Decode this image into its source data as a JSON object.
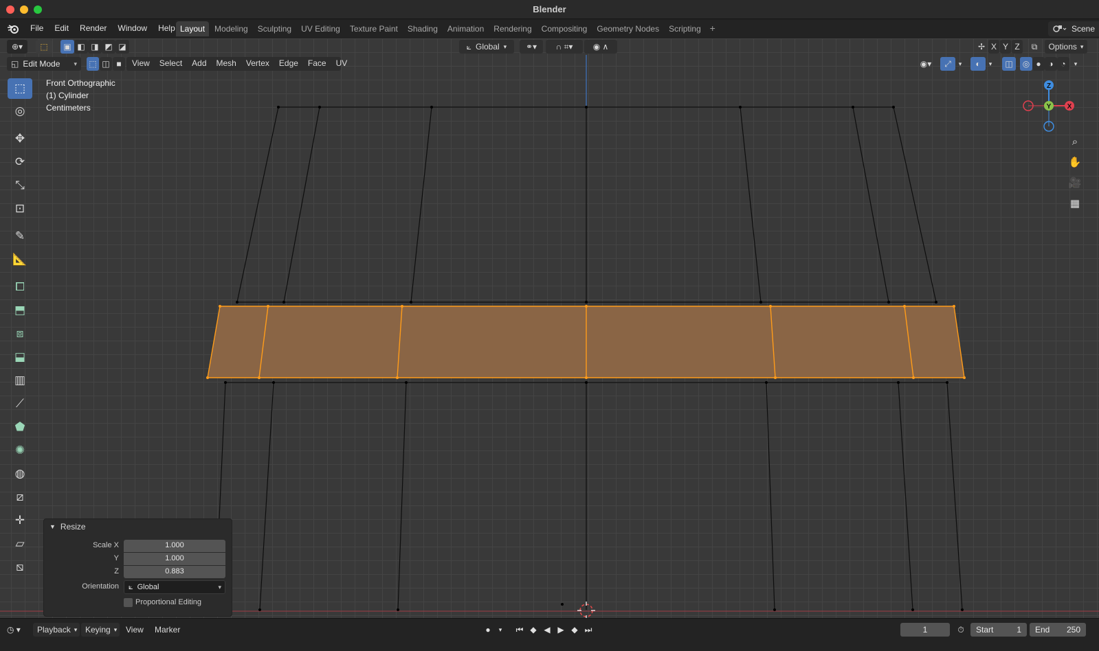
{
  "window": {
    "title": "Blender"
  },
  "menu": {
    "items": [
      "File",
      "Edit",
      "Render",
      "Window",
      "Help"
    ]
  },
  "workspaces": [
    {
      "label": "Layout",
      "active": true
    },
    {
      "label": "Modeling",
      "active": false
    },
    {
      "label": "Sculpting",
      "active": false
    },
    {
      "label": "UV Editing",
      "active": false
    },
    {
      "label": "Texture Paint",
      "active": false
    },
    {
      "label": "Shading",
      "active": false
    },
    {
      "label": "Animation",
      "active": false
    },
    {
      "label": "Rendering",
      "active": false
    },
    {
      "label": "Compositing",
      "active": false
    },
    {
      "label": "Geometry Nodes",
      "active": false
    },
    {
      "label": "Scripting",
      "active": false
    }
  ],
  "scene": {
    "label": "Scene"
  },
  "header": {
    "orientation": "Global",
    "axes": [
      "X",
      "Y",
      "Z"
    ],
    "options": "Options",
    "mode": "Edit Mode",
    "view_menu": [
      "View",
      "Select",
      "Add",
      "Mesh",
      "Vertex",
      "Edge",
      "Face",
      "UV"
    ]
  },
  "overlay": {
    "view_name": "Front Orthographic",
    "object": "(1) Cylinder",
    "units": "Centimeters"
  },
  "gizmo": {
    "z": "Z",
    "y": "Y",
    "x": "X"
  },
  "resize_panel": {
    "title": "Resize",
    "scale_x_label": "Scale X",
    "scale_x": "1.000",
    "y_label": "Y",
    "scale_y": "1.000",
    "z_label": "Z",
    "scale_z": "0.883",
    "orientation_label": "Orientation",
    "orientation": "Global",
    "proportional_label": "Proportional Editing",
    "proportional_checked": false
  },
  "timeline": {
    "playback": "Playback",
    "keying": "Keying",
    "view": "View",
    "marker": "Marker",
    "current_frame": "1",
    "start_label": "Start",
    "start": "1",
    "end_label": "End",
    "end": "250"
  },
  "colors": {
    "selection": "#ff9c1a",
    "selection_fill": "#8a6545",
    "accent": "#4772b3",
    "x_axis": "#e0404f",
    "y_axis": "#8bc34a",
    "z_axis": "#3f8de0"
  }
}
